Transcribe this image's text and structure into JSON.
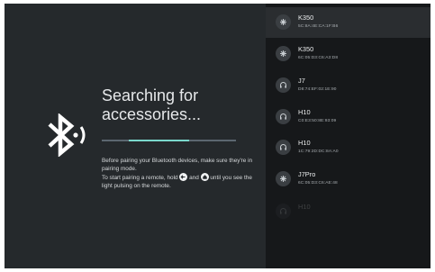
{
  "search": {
    "title": "Searching for accessories...",
    "progress": 0.45,
    "progress_offset": 0.2,
    "description_line1": "Before pairing your Bluetooth devices, make sure they're in pairing mode.",
    "description_line2_part1": "To start pairing a remote, hold",
    "description_line2_and": "and",
    "description_line2_part2": "until you see the light pulsing on the remote.",
    "back_button_icon": "back-arrow-icon",
    "home_button_icon": "home-icon"
  },
  "devices": [
    {
      "name": "K350",
      "address": "5C:8A:4E:CA:1F:B6",
      "icon": "keyboard-icon",
      "focused": true
    },
    {
      "name": "K350",
      "address": "6C:05:D3:C6:A3:D8",
      "icon": "keyboard-icon"
    },
    {
      "name": "J7",
      "address": "D8:74:EF:02:1E:90",
      "icon": "headphones-icon"
    },
    {
      "name": "H10",
      "address": "C0:E3:50:8E:93:09",
      "icon": "headphones-icon"
    },
    {
      "name": "H10",
      "address": "1C:79:2D:DC:8A:A0",
      "icon": "headphones-icon"
    },
    {
      "name": "J7Pro",
      "address": "6C:05:D3:C6:AE:48",
      "icon": "keyboard-icon"
    },
    {
      "name": "H10",
      "address": "",
      "icon": "headphones-icon",
      "faded": true
    }
  ],
  "colors": {
    "accent": "#7bd8cc",
    "left_bg": "#25292c",
    "right_bg": "#16181a"
  }
}
